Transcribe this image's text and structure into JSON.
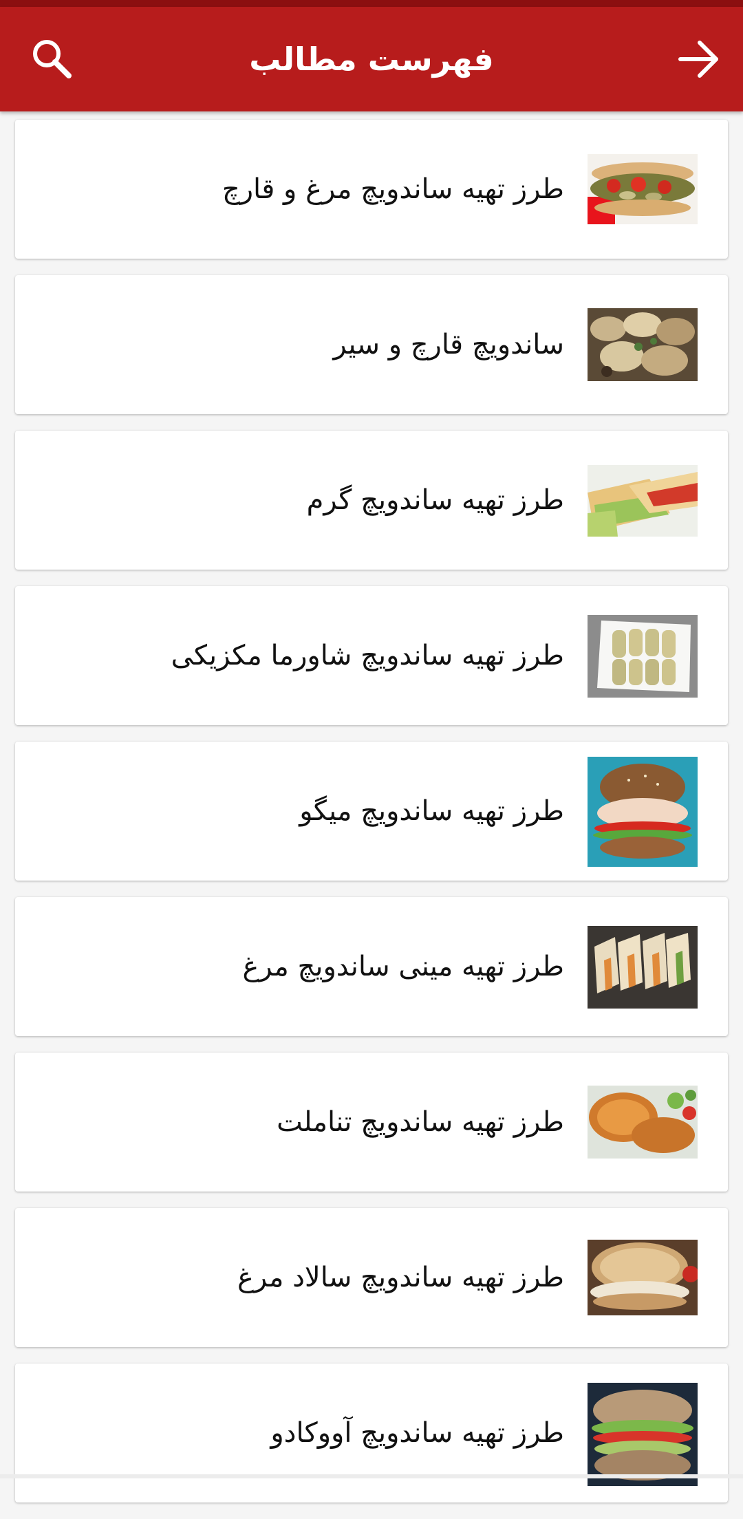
{
  "app_bar": {
    "title": "فهرست مطالب",
    "search_icon": "search-icon",
    "back_icon": "arrow-right-icon",
    "color": "#b71c1c",
    "status_color": "#8b0f10"
  },
  "items": [
    {
      "label": "طرز تهیه ساندویچ مرغ و قارچ",
      "thumb_icon": "chicken-mushroom-sandwich-image"
    },
    {
      "label": "ساندویچ قارچ و سیر",
      "thumb_icon": "mushroom-garlic-sandwich-image"
    },
    {
      "label": "طرز تهیه ساندویچ گرم",
      "thumb_icon": "hot-sandwich-image"
    },
    {
      "label": "طرز تهیه ساندویچ شاورما مکزیکی",
      "thumb_icon": "mexican-shawarma-image"
    },
    {
      "label": "طرز تهیه ساندویچ میگو",
      "thumb_icon": "shrimp-sandwich-image"
    },
    {
      "label": "طرز تهیه مینی ساندویچ مرغ",
      "thumb_icon": "mini-chicken-sandwich-image"
    },
    {
      "label": "طرز تهیه ساندویچ تناملت",
      "thumb_icon": "tuna-melt-image"
    },
    {
      "label": "طرز تهیه ساندویچ سالاد مرغ",
      "thumb_icon": "chicken-salad-sandwich-image"
    },
    {
      "label": "طرز تهیه ساندویچ آووکادو",
      "thumb_icon": "avocado-sandwich-image"
    }
  ]
}
